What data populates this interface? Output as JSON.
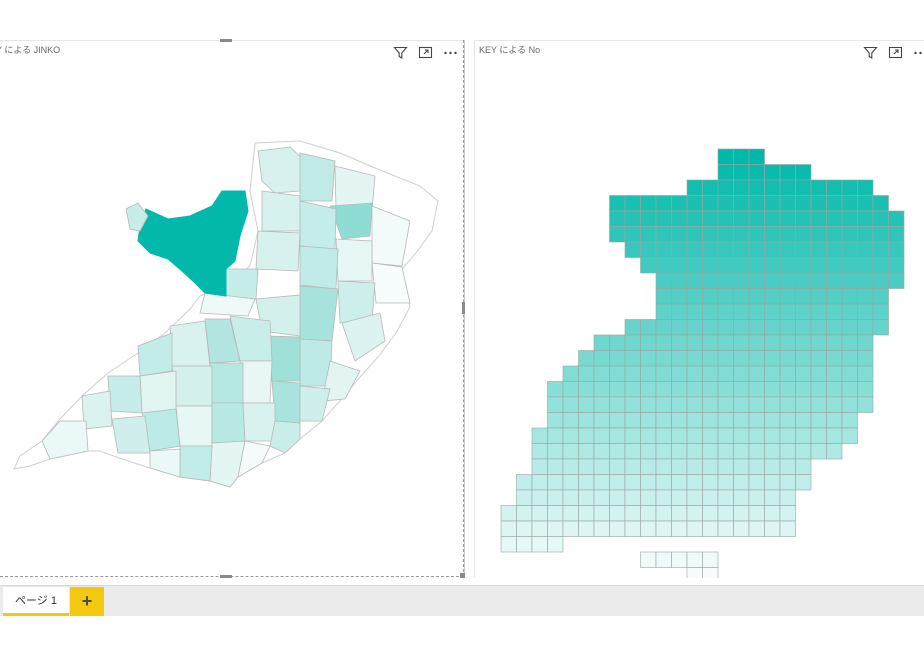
{
  "visuals": [
    {
      "title": "Y による JINKO",
      "icons": [
        "filter-icon",
        "focus-mode-icon",
        "more-options-icon"
      ]
    },
    {
      "title": "KEY による No",
      "icons": [
        "filter-icon",
        "focus-mode-icon",
        "more-options-icon"
      ]
    }
  ],
  "colors": {
    "accent": "#01b8aa",
    "map_stroke": "#c8c8c8",
    "tab_accent": "#f2c811"
  },
  "tabs": {
    "pages": [
      {
        "label": "ページ 1"
      }
    ],
    "add_label": "+"
  }
}
